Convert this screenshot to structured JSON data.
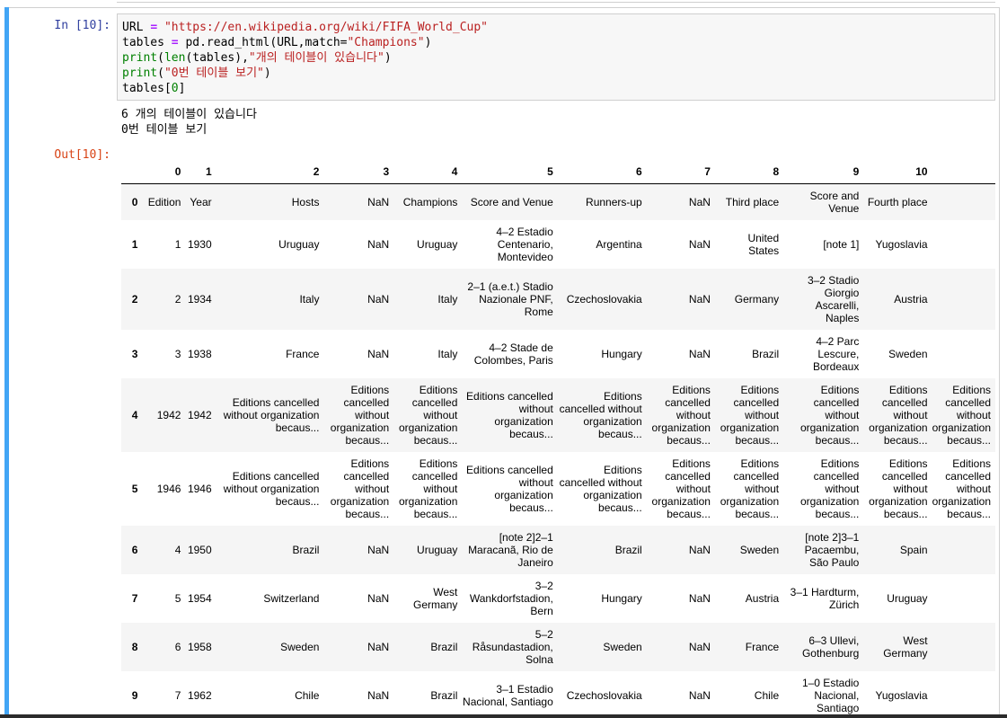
{
  "cell": {
    "in_prompt": "In [10]:",
    "out_prompt": "Out[10]:",
    "code": {
      "l1_var": "URL",
      "l1_eq": "=",
      "l1_str": "\"https://en.wikipedia.org/wiki/FIFA_World_Cup\"",
      "l2_a": "tables",
      "l2_eq": "=",
      "l2_b": "pd.read_html(URL,match=",
      "l2_str": "\"Champions\"",
      "l2_c": ")",
      "l3_fn": "print",
      "l3_a": "(",
      "l3_bi": "len",
      "l3_b": "(tables),",
      "l3_str": "\"개의 테이블이 있습니다\"",
      "l3_c": ")",
      "l4_fn": "print",
      "l4_a": "(",
      "l4_str": "\"0번 테이블 보기\"",
      "l4_c": ")",
      "l5_a": "tables[",
      "l5_num": "0",
      "l5_b": "]"
    },
    "stdout": "6 개의 테이블이 있습니다\n0번 테이블 보기"
  },
  "table": {
    "col_headers": [
      "",
      "0",
      "1",
      "2",
      "3",
      "4",
      "5",
      "6",
      "7",
      "8",
      "9",
      "10",
      ""
    ],
    "rows": [
      {
        "idx": "0",
        "cells": [
          "Edition",
          "Year",
          "Hosts",
          "NaN",
          "Champions",
          "Score and Venue",
          "Runners-up",
          "NaN",
          "Third place",
          "Score and Venue",
          "Fourth place",
          ""
        ]
      },
      {
        "idx": "1",
        "cells": [
          "1",
          "1930",
          "Uruguay",
          "NaN",
          "Uruguay",
          "4–2 Estadio Centenario, Montevideo",
          "Argentina",
          "NaN",
          "United States",
          "[note 1]",
          "Yugoslavia",
          ""
        ]
      },
      {
        "idx": "2",
        "cells": [
          "2",
          "1934",
          "Italy",
          "NaN",
          "Italy",
          "2–1 (a.e.t.) Stadio Nazionale PNF, Rome",
          "Czechoslovakia",
          "NaN",
          "Germany",
          "3–2 Stadio Giorgio Ascarelli, Naples",
          "Austria",
          ""
        ]
      },
      {
        "idx": "3",
        "cells": [
          "3",
          "1938",
          "France",
          "NaN",
          "Italy",
          "4–2 Stade de Colombes, Paris",
          "Hungary",
          "NaN",
          "Brazil",
          "4–2 Parc Lescure, Bordeaux",
          "Sweden",
          ""
        ]
      },
      {
        "idx": "4",
        "cells": [
          "1942",
          "1942",
          "Editions cancelled without organization becaus...",
          "Editions cancelled without organization becaus...",
          "Editions cancelled without organization becaus...",
          "Editions cancelled without organization becaus...",
          "Editions cancelled without organization becaus...",
          "Editions cancelled without organization becaus...",
          "Editions cancelled without organization becaus...",
          "Editions cancelled without organization becaus...",
          "Editions cancelled without organization becaus...",
          "Editions cancelled without organization becaus..."
        ]
      },
      {
        "idx": "5",
        "cells": [
          "1946",
          "1946",
          "Editions cancelled without organization becaus...",
          "Editions cancelled without organization becaus...",
          "Editions cancelled without organization becaus...",
          "Editions cancelled without organization becaus...",
          "Editions cancelled without organization becaus...",
          "Editions cancelled without organization becaus...",
          "Editions cancelled without organization becaus...",
          "Editions cancelled without organization becaus...",
          "Editions cancelled without organization becaus...",
          "Editions cancelled without organization becaus..."
        ]
      },
      {
        "idx": "6",
        "cells": [
          "4",
          "1950",
          "Brazil",
          "NaN",
          "Uruguay",
          "[note 2]2–1 Maracanã, Rio de Janeiro",
          "Brazil",
          "NaN",
          "Sweden",
          "[note 2]3–1 Pacaembu, São Paulo",
          "Spain",
          ""
        ]
      },
      {
        "idx": "7",
        "cells": [
          "5",
          "1954",
          "Switzerland",
          "NaN",
          "West Germany",
          "3–2 Wankdorfstadion, Bern",
          "Hungary",
          "NaN",
          "Austria",
          "3–1 Hardturm, Zürich",
          "Uruguay",
          ""
        ]
      },
      {
        "idx": "8",
        "cells": [
          "6",
          "1958",
          "Sweden",
          "NaN",
          "Brazil",
          "5–2 Råsundastadion, Solna",
          "Sweden",
          "NaN",
          "France",
          "6–3 Ullevi, Gothenburg",
          "West Germany",
          ""
        ]
      },
      {
        "idx": "9",
        "cells": [
          "7",
          "1962",
          "Chile",
          "NaN",
          "Brazil",
          "3–1 Estadio Nacional, Santiago",
          "Czechoslovakia",
          "NaN",
          "Chile",
          "1–0 Estadio Nacional, Santiago",
          "Yugoslavia",
          ""
        ]
      }
    ]
  }
}
